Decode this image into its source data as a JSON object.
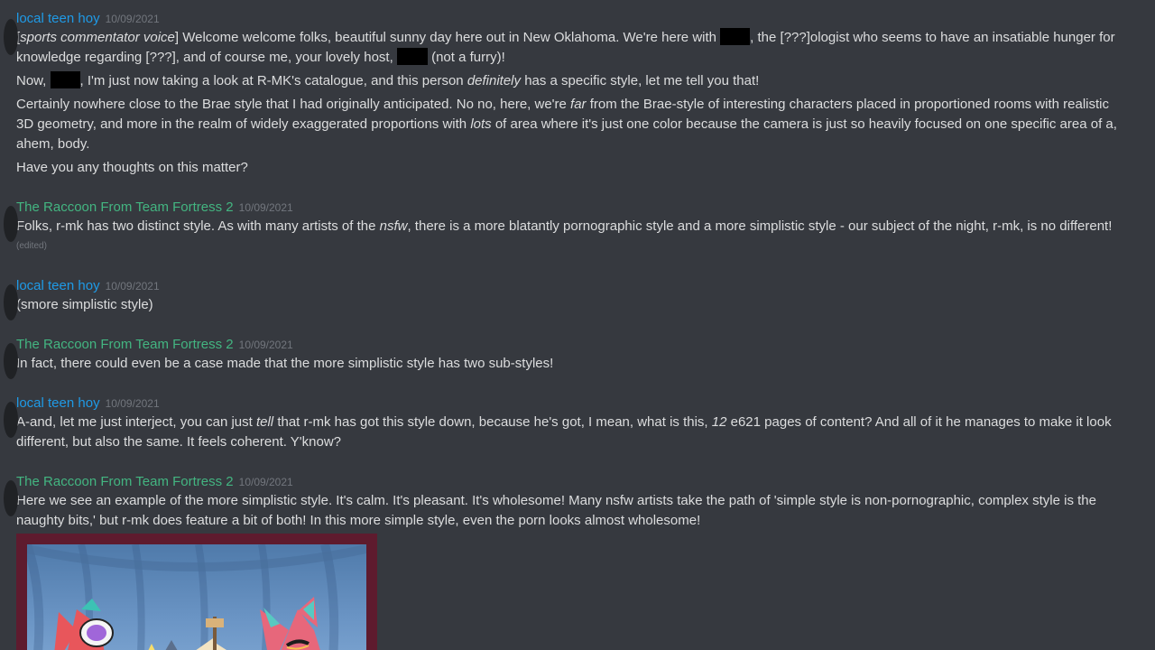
{
  "messages": [
    {
      "author": "local teen hoy",
      "timestamp": "10/09/2021",
      "color": "#1f9ae6",
      "l1a": "[",
      "l1b": "sports commentator voice",
      "l1c": "] Welcome welcome folks, beautiful sunny day here out in New Oklahoma. We're here with",
      "l1d": ", the [???]ologist who seems to have an insatiable hunger for",
      "l2a": "knowledge regarding [???], and of course me, your lovely host,",
      "l2b": "(not a furry)!",
      "l3a": "Now,",
      "l3b": ", I'm just now taking a look at R-MK's catalogue, and this person",
      "l3c": "definitely",
      "l3d": "has a specific style, let me tell you that!",
      "l4a": "Certainly nowhere close to the Brae style that I had originally anticipated. No no, here, we're",
      "l4b": "far",
      "l4c": "from the Brae-style of interesting characters placed in proportioned rooms with realistic",
      "l5a": "3D geometry, and more in the realm of widely exaggerated proportions with",
      "l5b": "lots",
      "l5c": "of area where it's just one color because the camera is just so heavily focused on one specific area of a,",
      "l6": "ahem, body.",
      "l7": "Have you any thoughts on this matter?"
    },
    {
      "author": "The Raccoon From Team Fortress 2",
      "timestamp": "10/09/2021",
      "color": "#43b581",
      "l1a": "Folks, r-mk has two distinct style. As with many artists of the",
      "l1b": "nsfw",
      "l1c": ", there is a more blatantly pornographic style and a more simplistic style - our subject of the night, r-mk, is no different!",
      "edited": "(edited)"
    },
    {
      "author": "local teen hoy",
      "timestamp": "10/09/2021",
      "color": "#1f9ae6",
      "l1": "(smore simplistic style)"
    },
    {
      "author": "The Raccoon From Team Fortress 2",
      "timestamp": "10/09/2021",
      "color": "#43b581",
      "l1": "In fact, there could even be a case made that the more simplistic style has two sub-styles!"
    },
    {
      "author": "local teen hoy",
      "timestamp": "10/09/2021",
      "color": "#1f9ae6",
      "l1a": "A-and, let me just interject, you can just",
      "l1b": "tell",
      "l1c": "that r-mk has got this style down, because he's got, I mean, what is this,",
      "l1d": "12",
      "l1e": "e621 pages of content? And all of it he manages to make it look",
      "l2": "different, but also the same. It feels coherent. Y'know?"
    },
    {
      "author": "The Raccoon From Team Fortress 2",
      "timestamp": "10/09/2021",
      "color": "#43b581",
      "l1": "Here we see an example of the more simplistic style. It's calm. It's pleasant. It's wholesome! Many nsfw artists take the path of 'simple style is non-pornographic, complex style is the",
      "l2": "naughty bits,' but r-mk does feature a bit of both! In this more simple style, even the porn looks almost wholesome!"
    }
  ]
}
